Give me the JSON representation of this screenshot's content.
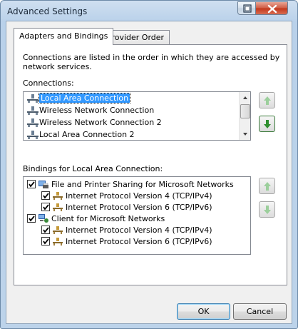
{
  "window": {
    "title": "Advanced Settings"
  },
  "tabs": [
    {
      "label": "Adapters and Bindings",
      "active": true
    },
    {
      "label": "Provider Order",
      "active": false
    }
  ],
  "description": {
    "line1": "Connections are listed in the order in which they are accessed by",
    "line2": "network services."
  },
  "connections": {
    "label": "Connections:",
    "items": [
      {
        "label": "Local Area Connection",
        "selected": true
      },
      {
        "label": "Wireless Network Connection",
        "selected": false
      },
      {
        "label": "Wireless Network Connection 2",
        "selected": false
      },
      {
        "label": "Local Area Connection 2",
        "selected": false
      }
    ]
  },
  "bindings": {
    "label": "Bindings for Local Area Connection:",
    "items": [
      {
        "label": "File and Printer Sharing for Microsoft Networks",
        "checked": true,
        "level": 0,
        "icon": "file-printer-sharing-icon"
      },
      {
        "label": "Internet Protocol Version 4 (TCP/IPv4)",
        "checked": true,
        "level": 1,
        "icon": "network-protocol-icon"
      },
      {
        "label": "Internet Protocol Version 6 (TCP/IPv6)",
        "checked": true,
        "level": 1,
        "icon": "network-protocol-icon"
      },
      {
        "label": "Client for Microsoft Networks",
        "checked": true,
        "level": 0,
        "icon": "network-client-icon"
      },
      {
        "label": "Internet Protocol Version 4 (TCP/IPv4)",
        "checked": true,
        "level": 1,
        "icon": "network-protocol-icon"
      },
      {
        "label": "Internet Protocol Version 6 (TCP/IPv6)",
        "checked": true,
        "level": 1,
        "icon": "network-protocol-icon"
      }
    ]
  },
  "buttons": {
    "ok": "OK",
    "cancel": "Cancel"
  },
  "colors": {
    "selection": "#3399ff",
    "arrow_green": "#3a9a3a",
    "arrow_green_disabled": "#9ccf9c"
  }
}
